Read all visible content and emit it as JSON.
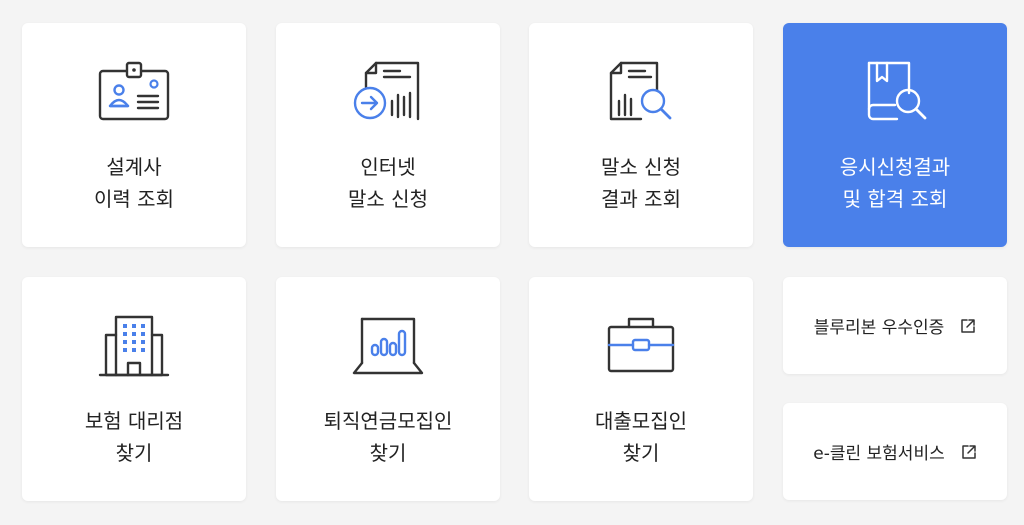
{
  "menu": {
    "tiles": [
      {
        "line1": "설계사",
        "line2": "이력 조회",
        "icon": "id-badge-icon"
      },
      {
        "line1": "인터넷",
        "line2": "말소 신청",
        "icon": "document-arrow-icon"
      },
      {
        "line1": "말소 신청",
        "line2": "결과 조회",
        "icon": "document-search-icon"
      },
      {
        "line1": "응시신청결과",
        "line2": "및 합격 조회",
        "icon": "book-search-icon"
      },
      {
        "line1": "보험 대리점",
        "line2": "찾기",
        "icon": "building-icon"
      },
      {
        "line1": "퇴직연금모집인",
        "line2": "찾기",
        "icon": "laptop-chart-icon"
      },
      {
        "line1": "대출모집인",
        "line2": "찾기",
        "icon": "briefcase-icon"
      }
    ],
    "links": [
      {
        "label": "블루리본 우수인증",
        "icon": "external-link-icon"
      },
      {
        "label": "e-클린 보험서비스",
        "icon": "external-link-icon"
      }
    ]
  },
  "colors": {
    "accent": "#4a80ea",
    "icon_stroke": "#333333",
    "icon_accent": "#4a80ea",
    "background": "#f4f4f4"
  }
}
